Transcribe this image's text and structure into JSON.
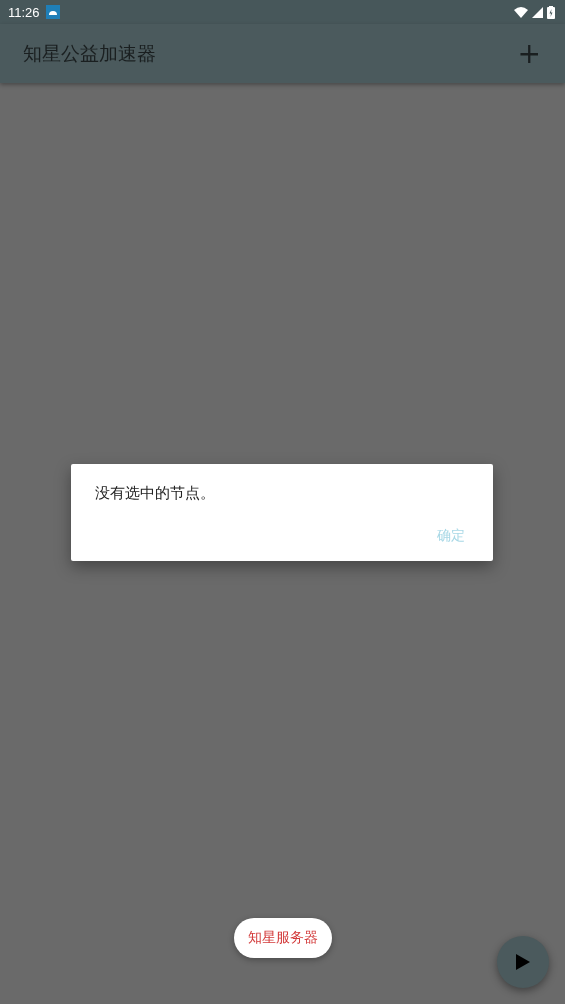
{
  "status_bar": {
    "time": "11:26"
  },
  "app_bar": {
    "title": "知星公益加速器",
    "action": "+"
  },
  "dialog": {
    "message": "没有选中的节点。",
    "buttons": [
      {
        "label": "确定",
        "disabled": true
      }
    ]
  },
  "chip": {
    "label": "知星服务器"
  }
}
